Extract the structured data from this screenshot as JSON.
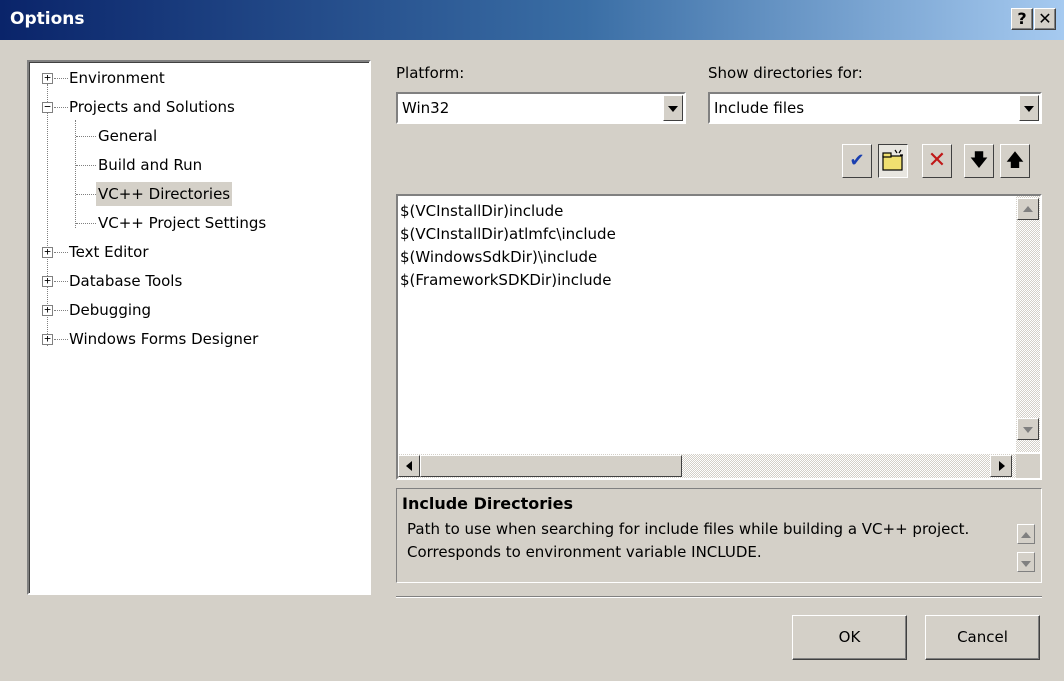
{
  "window": {
    "title": "Options",
    "help_label": "?",
    "close_label": "✕"
  },
  "tree": {
    "items": [
      {
        "label": "Environment",
        "expander": "+"
      },
      {
        "label": "Projects and Solutions",
        "expander": "−"
      },
      {
        "label": "General"
      },
      {
        "label": "Build and Run"
      },
      {
        "label": "VC++ Directories",
        "selected": true
      },
      {
        "label": "VC++ Project Settings"
      },
      {
        "label": "Text Editor",
        "expander": "+"
      },
      {
        "label": "Database Tools",
        "expander": "+"
      },
      {
        "label": "Debugging",
        "expander": "+"
      },
      {
        "label": "Windows Forms Designer",
        "expander": "+"
      }
    ]
  },
  "platform": {
    "label": "Platform:",
    "value": "Win32"
  },
  "show_dirs": {
    "label": "Show directories for:",
    "value": "Include files"
  },
  "toolbar": {
    "check_icon": "checkmark-icon",
    "newfolder_icon": "new-folder-icon",
    "delete_icon": "delete-x-icon",
    "down_icon": "move-down-icon",
    "up_icon": "move-up-icon"
  },
  "directories": [
    "$(VCInstallDir)include",
    "$(VCInstallDir)atlmfc\\include",
    "$(WindowsSdkDir)\\include",
    "$(FrameworkSDKDir)include"
  ],
  "description": {
    "title": "Include Directories",
    "line1": "Path to use when searching for include files while building a VC++ project.",
    "line2": "Corresponds to environment variable INCLUDE."
  },
  "buttons": {
    "ok": "OK",
    "cancel": "Cancel"
  },
  "colors": {
    "title_start": "#0a246a",
    "title_end": "#a6caf0",
    "face": "#d4d0c8"
  }
}
